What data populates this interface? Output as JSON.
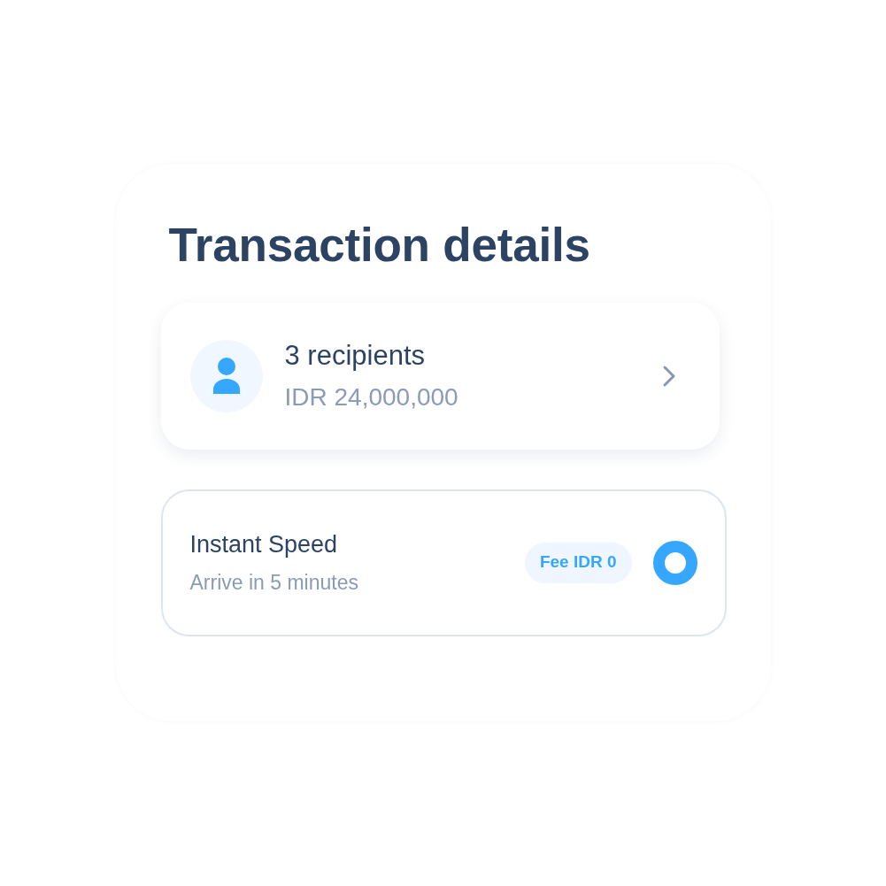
{
  "title": "Transaction details",
  "recipients_card": {
    "title": "3 recipients",
    "amount": "IDR 24,000,000"
  },
  "speed_options": [
    {
      "name": "Instant Speed",
      "eta": "Arrive in 5 minutes",
      "fee": "Fee IDR 0",
      "selected": true
    }
  ]
}
